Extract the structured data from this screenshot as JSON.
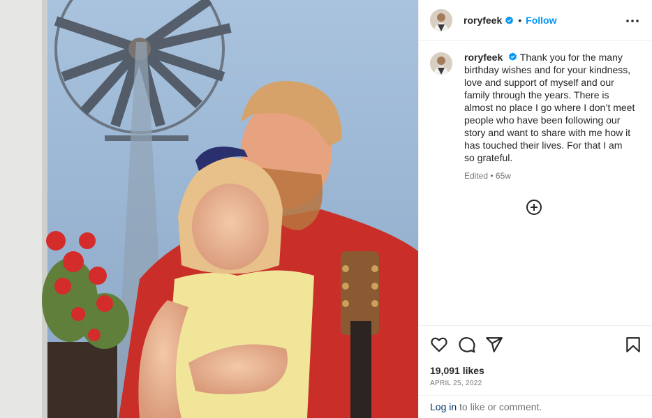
{
  "post": {
    "username": "roryfeek",
    "follow_label": "Follow",
    "separator": "•",
    "caption": "Thank you for the many birthday wishes and for your kindness, love and support of myself and our family through the years. There is almost no place I go where I don’t meet people who have been following our story and want to share with me how it has touched their lives. For that I am so grateful.",
    "edited_label": "Edited",
    "meta_separator": " • ",
    "age": "65w",
    "likes": "19,091 likes",
    "date": "APRIL 25, 2022",
    "login_link": "Log in",
    "login_text": " to like or comment."
  },
  "colors": {
    "accent": "#0095f6",
    "link": "#00376b",
    "secondary_text": "#737373",
    "border": "#efefef"
  },
  "icons": [
    "verified-badge-icon",
    "more-options-icon",
    "add-comment-icon",
    "heart-icon",
    "comment-icon",
    "share-icon",
    "bookmark-icon"
  ]
}
